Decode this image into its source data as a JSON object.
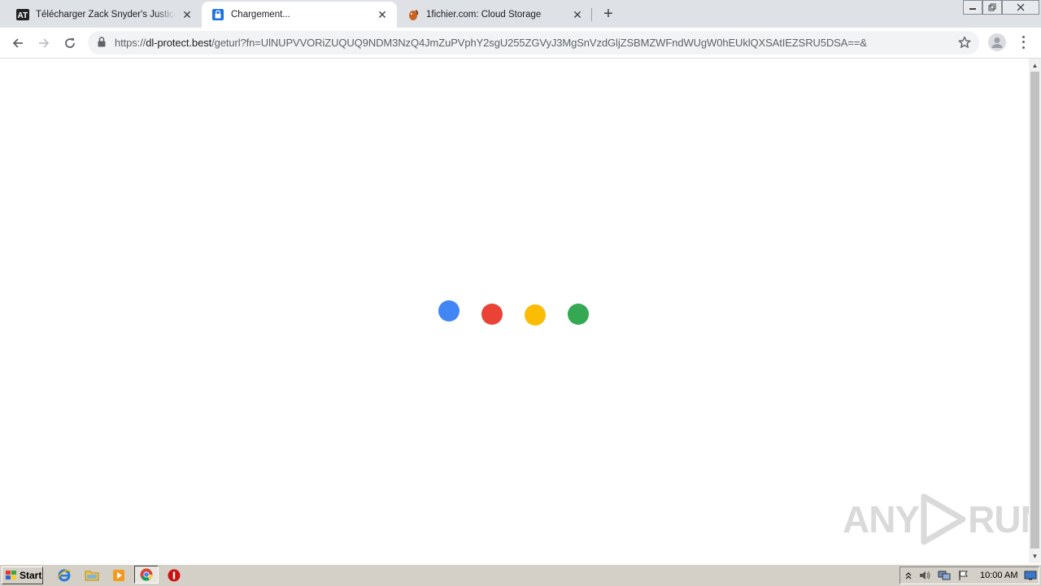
{
  "browser": {
    "tabs": [
      {
        "title": "Télécharger Zack Snyder's Justice League",
        "favicon": "at-logo-icon",
        "active": false
      },
      {
        "title": "Chargement...",
        "favicon": "lock-page-icon",
        "active": true
      },
      {
        "title": "1fichier.com: Cloud Storage",
        "favicon": "squirrel-icon",
        "active": false
      }
    ],
    "new_tab_label": "+",
    "close_glyph": "✕",
    "url": {
      "scheme": "https://",
      "host": "dl-protect.best",
      "path": "/geturl?fn=UlNUPVVORiZUQUQ9NDM3NzQ4JmZuPVphY2sgU255ZGVyJ3MgSnVzdGljZSBMZWFndWUgW0hEUklQXSAtIEZSRU5DSA==&"
    }
  },
  "loader": {
    "colors": [
      "#4285f4",
      "#ea4335",
      "#fbbc05",
      "#34a853"
    ]
  },
  "watermark": {
    "text_left": "ANY",
    "text_right": "RUN"
  },
  "taskbar": {
    "start_label": "Start",
    "clock": "10:00 AM",
    "quicklaunch": [
      "internet-explorer-icon",
      "folder-icon",
      "media-player-icon",
      "chrome-icon",
      "stop-sign-icon"
    ]
  }
}
